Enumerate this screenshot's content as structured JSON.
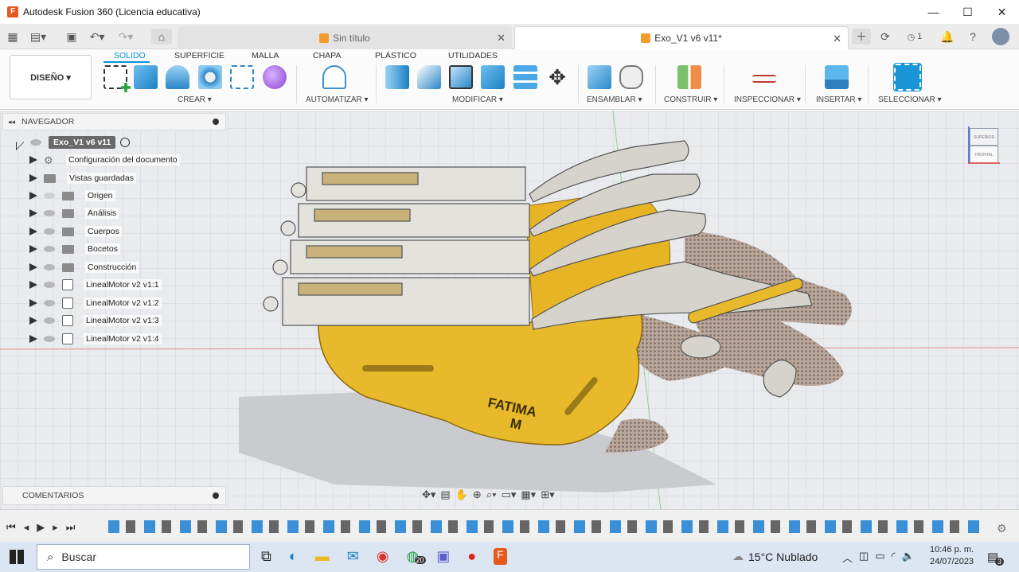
{
  "window": {
    "title": "Autodesk Fusion 360 (Licencia educativa)",
    "minimize_icon": "minimize-icon",
    "maximize_icon": "maximize-icon",
    "close_icon": "close-icon"
  },
  "tabs": [
    {
      "label": "Sin título",
      "active": false
    },
    {
      "label": "Exo_V1 v6 v11*",
      "active": true
    }
  ],
  "toolbar_right": {
    "jobs_count": "1"
  },
  "workspace": {
    "label": "DISEÑO ▾"
  },
  "ribbon_tabs": [
    "SOLIDO",
    "SUPERFICIE",
    "MALLA",
    "CHAPA",
    "PLÁSTICO",
    "UTILIDADES"
  ],
  "ribbon_groups": [
    "CREAR ▾",
    "AUTOMATIZAR ▾",
    "MODIFICAR ▾",
    "ENSAMBLAR ▾",
    "CONSTRUIR ▾",
    "INSPECCIONAR ▾",
    "INSERTAR ▾",
    "SELECCIONAR ▾"
  ],
  "navigator": {
    "header": "NAVEGADOR",
    "root": "Exo_V1 v6 v11",
    "items": [
      {
        "label": "Configuración del documento",
        "type": "settings"
      },
      {
        "label": "Vistas guardadas",
        "type": "folder"
      },
      {
        "label": "Origen",
        "type": "folder"
      },
      {
        "label": "Análisis",
        "type": "folder"
      },
      {
        "label": "Cuerpos",
        "type": "folder"
      },
      {
        "label": "Bocetos",
        "type": "folder"
      },
      {
        "label": "Construcción",
        "type": "folder"
      },
      {
        "label": "LinealMotor v2 v1:1",
        "type": "component"
      },
      {
        "label": "LinealMotor v2 v1:2",
        "type": "component"
      },
      {
        "label": "LinealMotor v2 v1:3",
        "type": "component"
      },
      {
        "label": "LinealMotor v2 v1:4",
        "type": "component"
      }
    ]
  },
  "comments": {
    "label": "COMENTARIOS"
  },
  "viewcube": {
    "top": "SUPERIOR",
    "front": "FRONTAL"
  },
  "model": {
    "engraving_line1": "FATIMA",
    "engraving_line2": "M"
  },
  "taskbar": {
    "search_placeholder": "Buscar",
    "whatsapp_badge": "20",
    "weather": "15°C  Nublado",
    "time": "10:46 p. m.",
    "date": "24/07/2023",
    "notification_count": "3"
  },
  "colors": {
    "accent": "#0696d7",
    "model_yellow": "#e8b92a",
    "model_grey": "#d9d6cf",
    "app_orange": "#e5591c"
  }
}
